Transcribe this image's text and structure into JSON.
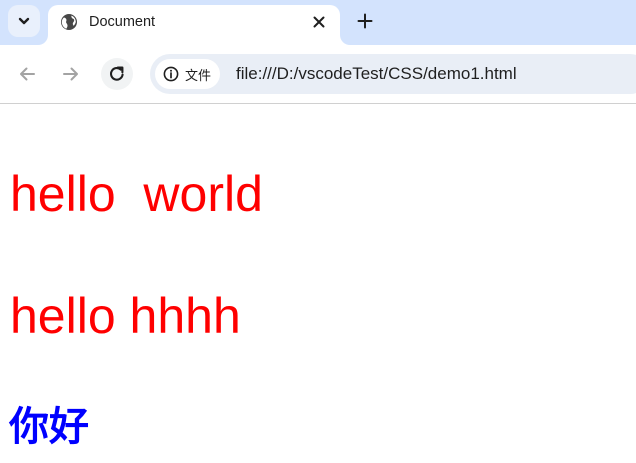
{
  "tab": {
    "title": "Document",
    "favicon": "globe-icon",
    "close_icon": "close-icon"
  },
  "toolbar": {
    "tab_search_icon": "chevron-down-icon",
    "new_tab_icon": "plus-icon",
    "back_icon": "arrow-left-icon",
    "forward_icon": "arrow-right-icon",
    "reload_icon": "reload-icon"
  },
  "omnibox": {
    "chip_icon": "info-icon",
    "chip_label": "文件",
    "url": "file:///D:/vscodeTest/CSS/demo1.html"
  },
  "content": {
    "line1": "hello  world",
    "line2": "hello hhhh",
    "line3": "你好"
  },
  "colors": {
    "tab_strip_bg": "#d3e3fd",
    "omnibox_bg": "#e9eef6",
    "red_text": "#ff0000",
    "blue_text": "#0000ff"
  }
}
